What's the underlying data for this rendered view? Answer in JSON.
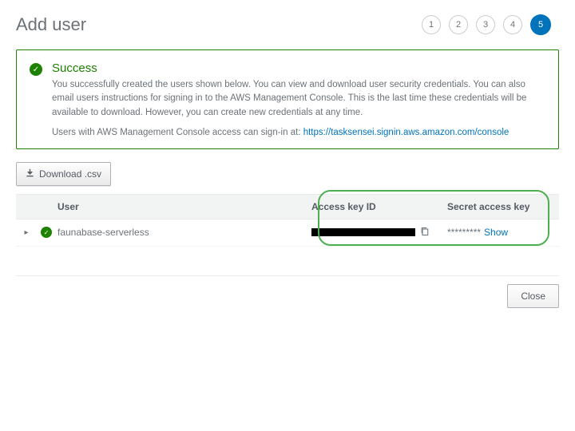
{
  "header": {
    "title": "Add user",
    "steps": [
      "1",
      "2",
      "3",
      "4",
      "5"
    ],
    "active_step": 4
  },
  "alert": {
    "title": "Success",
    "text": "You successfully created the users shown below. You can view and download user security credentials. You can also email users instructions for signing in to the AWS Management Console. This is the last time these credentials will be available to download. However, you can create new credentials at any time.",
    "text2_prefix": "Users with AWS Management Console access can sign-in at: ",
    "signin_url": "https://tasksensei.signin.aws.amazon.com/console"
  },
  "download_btn": "Download .csv",
  "table": {
    "headers": {
      "user": "User",
      "access_key": "Access key ID",
      "secret": "Secret access key"
    },
    "row": {
      "username": "faunabase-serverless",
      "secret_masked": "*********",
      "show_label": "Show"
    }
  },
  "close_btn": "Close"
}
